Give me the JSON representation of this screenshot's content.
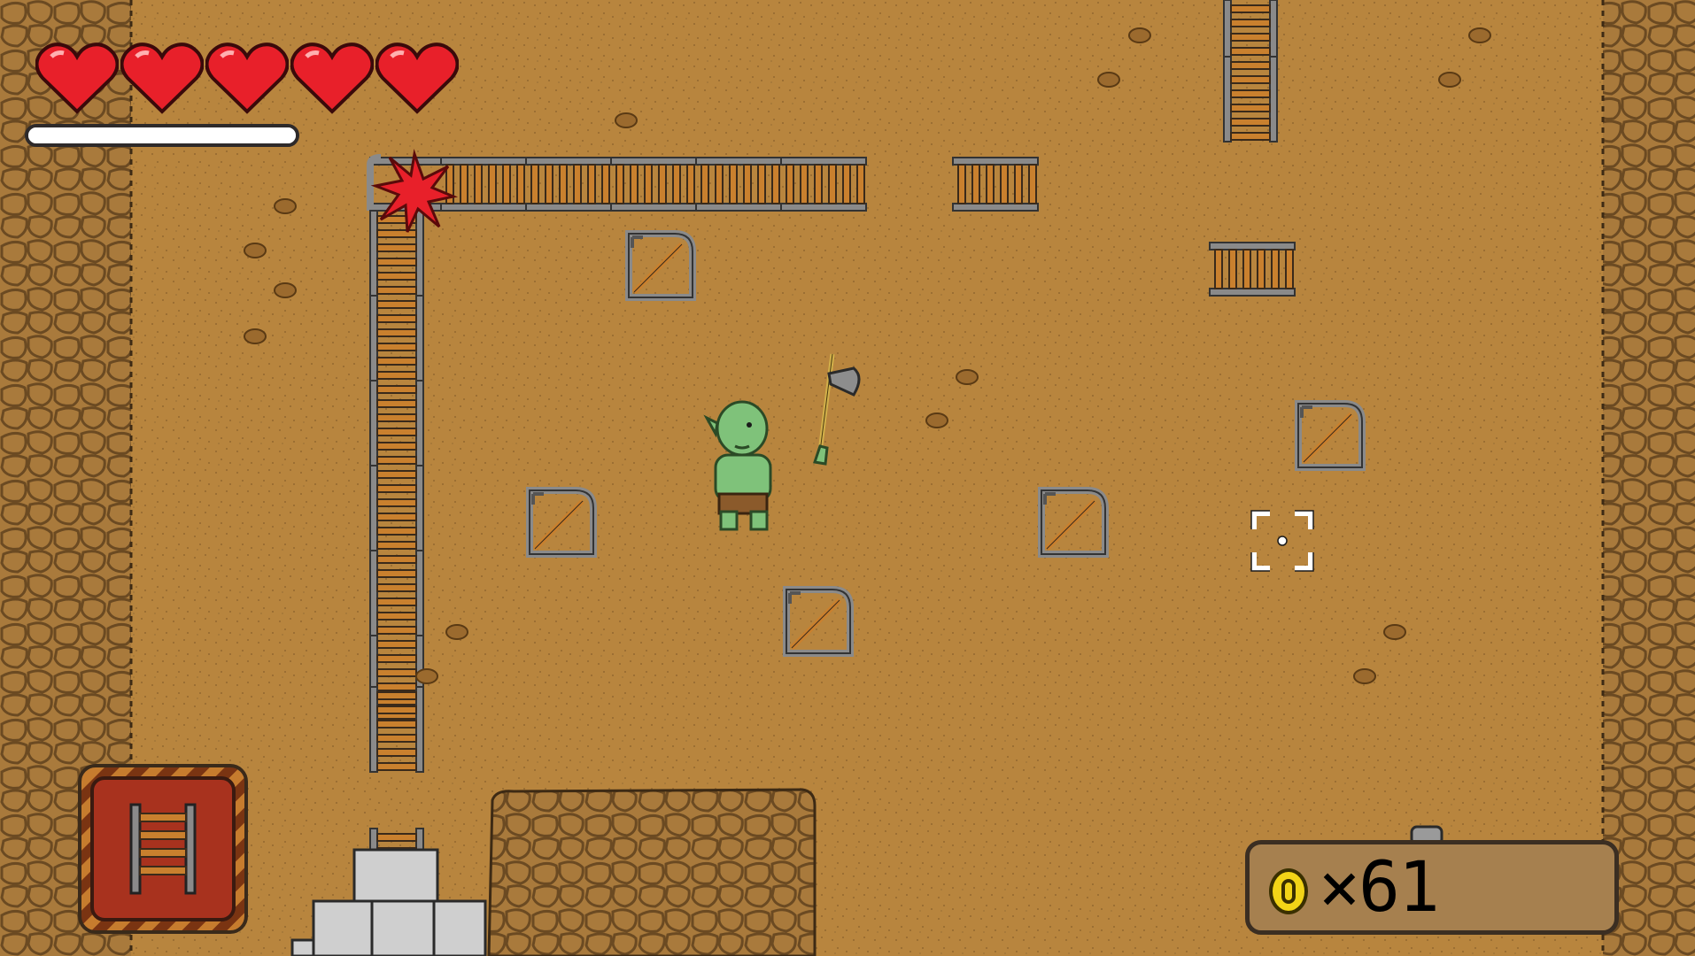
{
  "hud": {
    "hearts": {
      "full": 5,
      "max": 5
    },
    "stamina_fraction": 1.0,
    "selected_item": "rail-track-icon",
    "coins": {
      "icon": "coin-icon",
      "label": "×61"
    }
  },
  "colors": {
    "ground": "#b8853e",
    "rock_wall": "#a97a3c",
    "heart_red": "#e8202a",
    "rail_metal": "#8a8a8a",
    "rail_wood": "#c9802e",
    "orc_green": "#7fc27a"
  },
  "world": {
    "player": "orc-player",
    "weapon": "battle-axe-icon",
    "obstacle": "red-spiky-bush",
    "items": [
      "rail-track",
      "rail-corner",
      "stone-building"
    ]
  }
}
